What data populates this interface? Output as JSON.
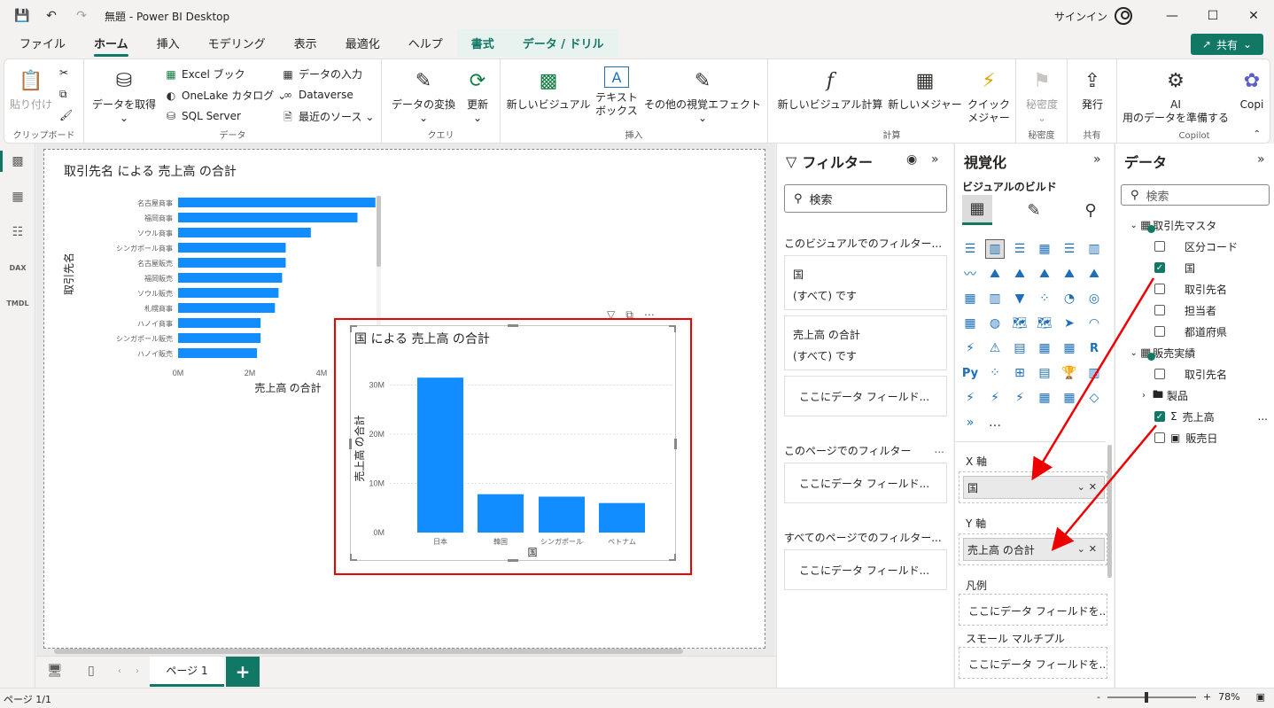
{
  "window": {
    "title": "無題 - Power BI Desktop",
    "signin": "サインイン"
  },
  "menu": {
    "tabs": [
      {
        "label": "ファイル"
      },
      {
        "label": "ホーム"
      },
      {
        "label": "挿入"
      },
      {
        "label": "モデリング"
      },
      {
        "label": "表示"
      },
      {
        "label": "最適化"
      },
      {
        "label": "ヘルプ"
      },
      {
        "label": "書式"
      },
      {
        "label": "データ / ドリル"
      }
    ],
    "share": "共有"
  },
  "ribbon": {
    "clipboard": {
      "paste": "貼り付け",
      "label": "クリップボード"
    },
    "data": {
      "get_data": "データを取得",
      "excel": "Excel ブック",
      "onelake": "OneLake カタログ",
      "sql": "SQL Server",
      "enter_data": "データの入力",
      "dataverse": "Dataverse",
      "recent": "最近のソース",
      "label": "データ"
    },
    "query": {
      "transform": "データの変換",
      "refresh": "更新",
      "label": "クエリ"
    },
    "insert": {
      "new_visual": "新しいビジュアル",
      "textbox_1": "テキスト",
      "textbox_2": "ボックス",
      "more_visuals": "その他の視覚エフェクト",
      "label": "挿入"
    },
    "calc": {
      "new_visual_calc": "新しいビジュアル計算",
      "new_measure": "新しいメジャー",
      "quick_1": "クイック",
      "quick_2": "メジャー",
      "label": "計算"
    },
    "sensitivity": {
      "btn": "秘密度",
      "label": "秘密度"
    },
    "share": {
      "publish": "発行",
      "label": "共有"
    },
    "copilot": {
      "ai_1": "AI",
      "ai_2": "用のデータを準備する",
      "copilot": "Copi",
      "label": "Copilot"
    }
  },
  "chart1": {
    "title": "取引先名 による 売上高 の合計"
  },
  "chart2": {
    "title": "国 による 売上高 の合計"
  },
  "chart_data": [
    {
      "type": "bar",
      "orientation": "horizontal",
      "title": "取引先名 による 売上高 の合計",
      "xlabel": "売上高 の合計",
      "ylabel": "取引先名",
      "categories": [
        "名古屋商事",
        "福岡商事",
        "ソウル商事",
        "シンガポール商事",
        "名古屋販売",
        "福岡販売",
        "ソウル販売",
        "札幌商事",
        "ハノイ商事",
        "シンガポール販売",
        "ハノイ販売"
      ],
      "values": [
        5.5,
        5.0,
        3.7,
        3.0,
        3.0,
        2.9,
        2.8,
        2.7,
        2.3,
        2.3,
        2.2
      ],
      "xlim": [
        0,
        4
      ],
      "xticks": [
        "0M",
        "2M",
        "4M"
      ],
      "unit": "M",
      "color": "#118DFF"
    },
    {
      "type": "bar",
      "orientation": "vertical",
      "title": "国 による 売上高 の合計",
      "xlabel": "国",
      "ylabel": "売上高 の合計",
      "categories": [
        "日本",
        "韓国",
        "シンガポール",
        "ベトナム"
      ],
      "values": [
        31.5,
        7.8,
        7.3,
        6.0
      ],
      "ylim": [
        0,
        30
      ],
      "yticks": [
        "0M",
        "10M",
        "20M",
        "30M"
      ],
      "unit": "M",
      "grid": true,
      "color": "#118DFF"
    }
  ],
  "pagebar": {
    "page": "ページ 1"
  },
  "status": {
    "page": "ページ 1/1",
    "zoom": "78%"
  },
  "filters": {
    "title": "フィルター",
    "search_placeholder": "検索",
    "this_visual": "このビジュアルでのフィルター...",
    "card1_field": "国",
    "card1_value": "(すべて) です",
    "card2_field": "売上高 の合計",
    "card2_value": "(すべて) です",
    "drop": "ここにデータ フィールド...",
    "this_page": "このページでのフィルター",
    "all_pages": "すべてのページでのフィルター...",
    "dots": "..."
  },
  "viz": {
    "title": "視覚化",
    "build": "ビジュアルのビルド",
    "x_axis": "X 軸",
    "x_field": "国",
    "y_axis": "Y 軸",
    "y_field": "売上高 の合計",
    "legend": "凡例",
    "legend_ph": "ここにデータ フィールドを...",
    "small_multiples": "スモール マルチプル",
    "sm_ph": "ここにデータ フィールドを...",
    "more": "..."
  },
  "datapane": {
    "title": "データ",
    "search_placeholder": "検索",
    "tables": [
      {
        "name": "取引先マスタ",
        "fields": [
          {
            "name": "区分コード",
            "checked": false
          },
          {
            "name": "国",
            "checked": true
          },
          {
            "name": "取引先名",
            "checked": false
          },
          {
            "name": "担当者",
            "checked": false
          },
          {
            "name": "都道府県",
            "checked": false
          }
        ]
      },
      {
        "name": "販売実績",
        "fields": [
          {
            "name": "取引先名",
            "checked": false
          },
          {
            "name": "製品",
            "checked": false
          },
          {
            "name": "売上高",
            "checked": true
          },
          {
            "name": "販売日",
            "checked": false
          }
        ]
      }
    ],
    "more": "..."
  },
  "colors": {
    "accent": "#117865",
    "bar": "#118DFF",
    "highlight": "#E00000"
  }
}
